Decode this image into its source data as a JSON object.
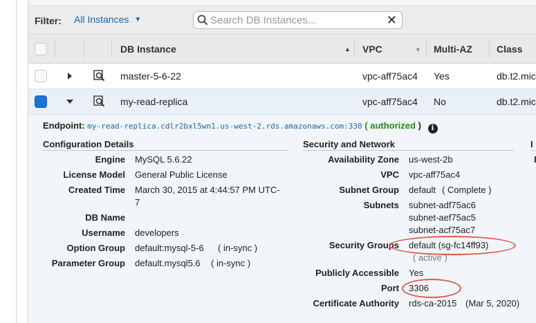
{
  "filter": {
    "label": "Filter:",
    "selected": "All Instances",
    "search_placeholder": "Search DB Instances..."
  },
  "columns": {
    "db_instance": "DB Instance",
    "vpc": "VPC",
    "multi_az": "Multi-AZ",
    "class": "Class"
  },
  "rows": [
    {
      "name": "master-5-6-22",
      "vpc": "vpc-aff75ac4",
      "multi_az": "Yes",
      "class": "db.t2.mic",
      "expanded": false,
      "selected": false
    },
    {
      "name": "my-read-replica",
      "vpc": "vpc-aff75ac4",
      "multi_az": "No",
      "class": "db.t2.mic",
      "expanded": true,
      "selected": true
    }
  ],
  "details": {
    "endpoint_label": "Endpoint:",
    "endpoint_value": "my-read-replica.cdlr2bxl5wn1.us-west-2.rds.amazonaws.com:330",
    "endpoint_status_open": "(",
    "endpoint_status": "authorized",
    "endpoint_status_close": ")",
    "config_title": "Configuration Details",
    "network_title": "Security and Network",
    "third_title": "I",
    "third_item": "I",
    "config": {
      "engine_label": "Engine",
      "engine": "MySQL 5.6.22",
      "license_label": "License Model",
      "license": "General Public License",
      "created_label": "Created Time",
      "created_line1": "March 30, 2015 at 4:44:57 PM UTC-",
      "created_line2": "7",
      "dbname_label": "DB Name",
      "dbname": "",
      "username_label": "Username",
      "username": "developers",
      "option_label": "Option Group",
      "option_value": "default:mysql-5-6",
      "option_status": "( in-sync )",
      "param_label": "Parameter Group",
      "param_value": "default.mysql5.6",
      "param_status": "( in-sync )"
    },
    "network": {
      "az_label": "Availability Zone",
      "az": "us-west-2b",
      "vpc_label": "VPC",
      "vpc": "vpc-aff75ac4",
      "subnet_group_label": "Subnet Group",
      "subnet_group": "default",
      "subnet_group_status": "( Complete )",
      "subnets_label": "Subnets",
      "subnets": [
        "subnet-adf75ac6",
        "subnet-aef75ac5",
        "subnet-acf75ac7"
      ],
      "sg_label": "Security Groups",
      "sg_value": "default (sg-fc14ff93)",
      "sg_status": "( active )",
      "public_label": "Publicly Accessible",
      "public": "Yes",
      "port_label": "Port",
      "port": "3306",
      "cert_label": "Certificate Authority",
      "cert": "rds-ca-2015",
      "cert_date": "(Mar 5, 2020)"
    }
  },
  "colors": {
    "accent": "#1a66b2",
    "ok": "#1d8f1d",
    "highlight_oval": "#e05a4e",
    "selected_checkbox": "#1a73d6"
  },
  "icons": [
    "chevron-down-icon",
    "search-icon",
    "close-icon",
    "sort-up-icon",
    "sort-down-icon",
    "expand-right-icon",
    "collapse-down-icon",
    "zoom-icon",
    "info-icon"
  ]
}
